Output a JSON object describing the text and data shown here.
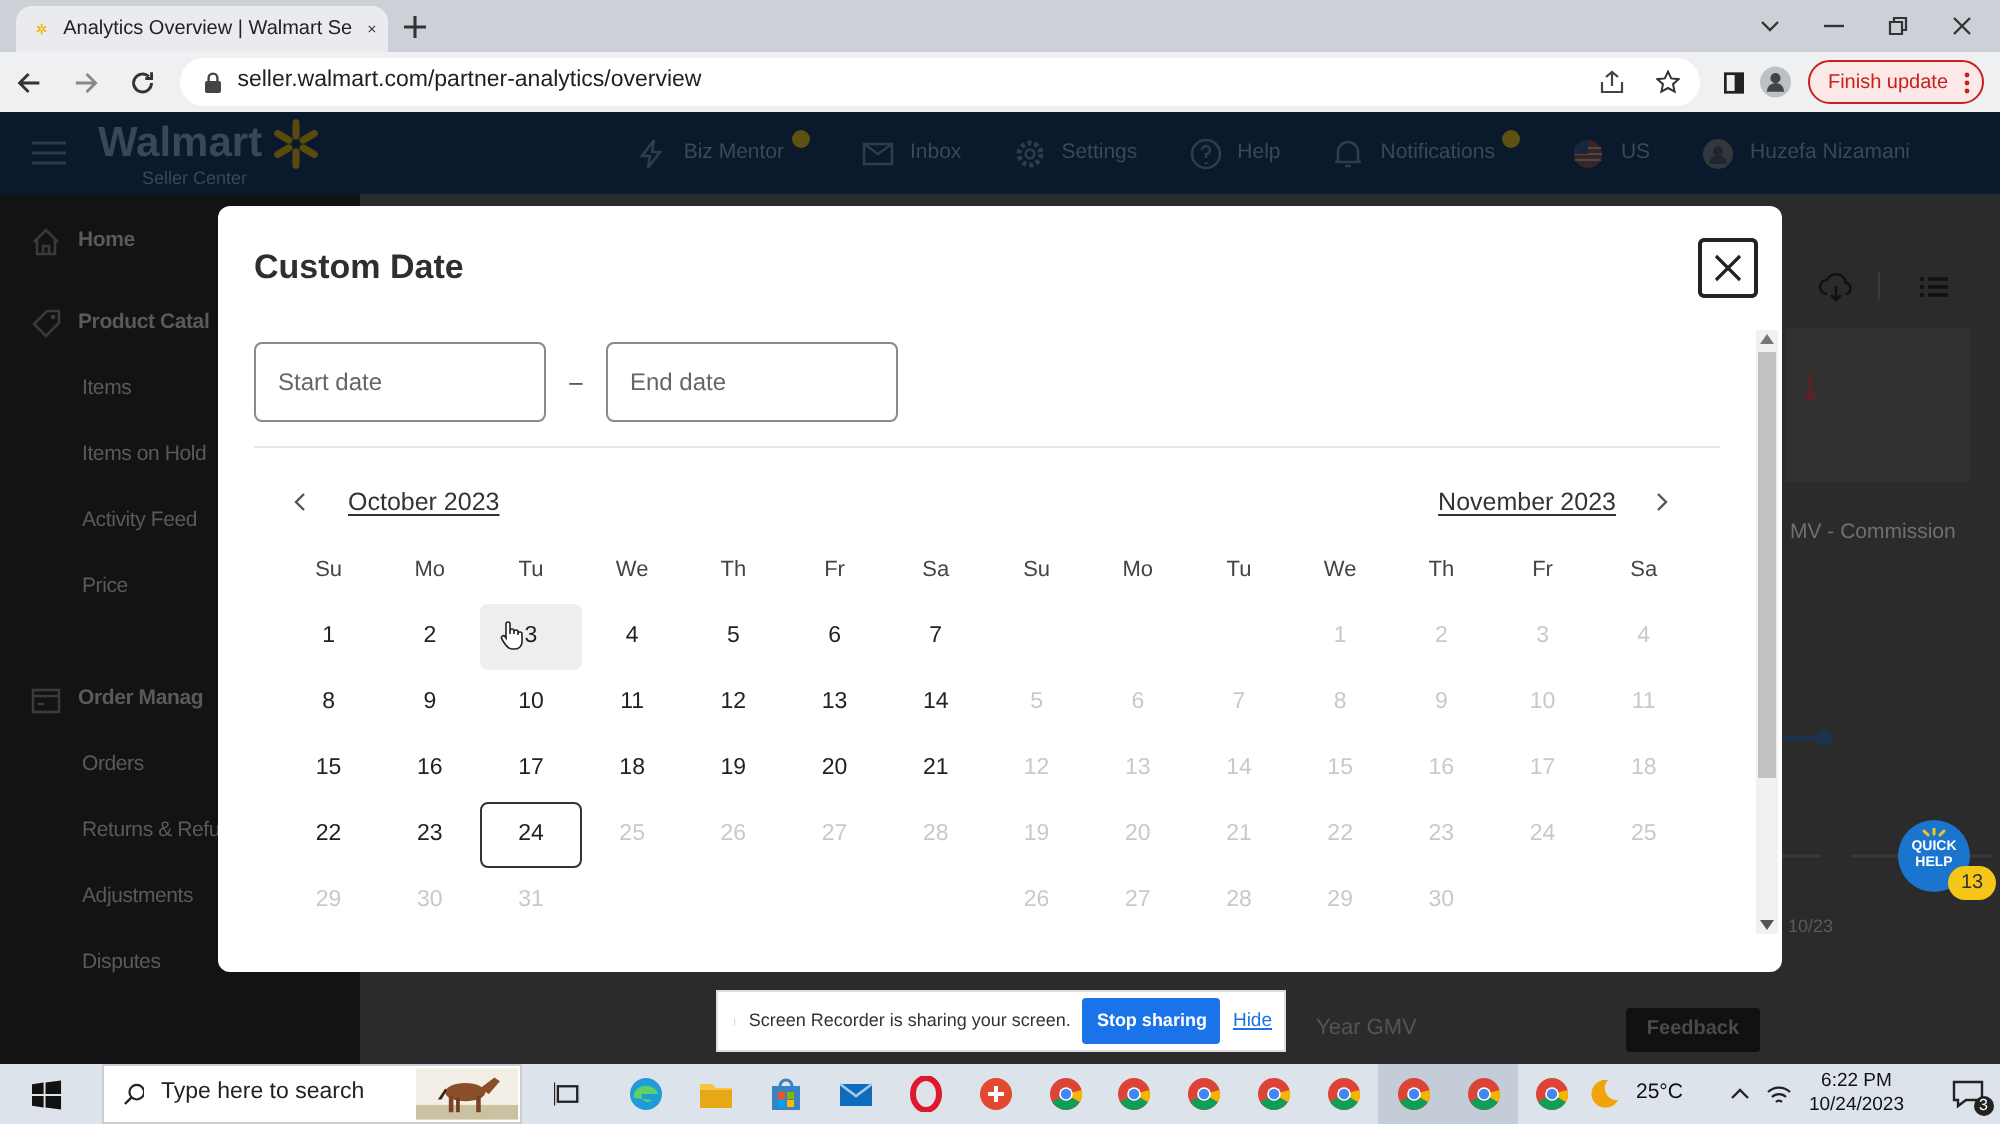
{
  "browser": {
    "tab_title": "Analytics Overview | Walmart Se",
    "url": "seller.walmart.com/partner-analytics/overview",
    "update_button": "Finish update"
  },
  "app_header": {
    "logo": "Walmart",
    "logo_subtitle": "Seller Center",
    "items": [
      {
        "label": "Biz Mentor",
        "badge": true
      },
      {
        "label": "Inbox",
        "badge": false
      },
      {
        "label": "Settings",
        "badge": false
      },
      {
        "label": "Help",
        "badge": false
      },
      {
        "label": "Notifications",
        "badge": true
      },
      {
        "label": "US",
        "badge": false
      },
      {
        "label": "Huzefa Nizamani",
        "badge": false
      }
    ]
  },
  "sidebar": {
    "items": [
      {
        "label": "Home"
      },
      {
        "label": "Product Catal",
        "children": [
          {
            "label": "Items"
          },
          {
            "label": "Items on Hold"
          },
          {
            "label": "Activity Feed"
          },
          {
            "label": "Price"
          }
        ]
      },
      {
        "label": "Order Manag",
        "children": [
          {
            "label": "Orders"
          },
          {
            "label": "Returns & Refu"
          },
          {
            "label": "Adjustments"
          },
          {
            "label": "Disputes"
          }
        ]
      }
    ]
  },
  "page": {
    "chart_label": "MV - Commission",
    "chart_date": "10/23",
    "footer_label": "Year GMV",
    "feedback_button": "Feedback"
  },
  "modal": {
    "title": "Custom Date",
    "start_field": {
      "placeholder": "Start date"
    },
    "separator": "–",
    "end_field": {
      "placeholder": "End date"
    },
    "months": [
      {
        "kind": "prev",
        "title": "October 2023",
        "weekdays": [
          "Su",
          "Mo",
          "Tu",
          "We",
          "Th",
          "Fr",
          "Sa"
        ],
        "days": [
          {
            "kind": "day",
            "label": "1",
            "disabled": false,
            "today": false,
            "hovered": false
          },
          {
            "kind": "day",
            "label": "2",
            "disabled": false,
            "today": false,
            "hovered": false
          },
          {
            "kind": "day",
            "label": "3",
            "disabled": false,
            "today": false,
            "hovered": true
          },
          {
            "kind": "day",
            "label": "4",
            "disabled": false,
            "today": false,
            "hovered": false
          },
          {
            "kind": "day",
            "label": "5",
            "disabled": false,
            "today": false,
            "hovered": false
          },
          {
            "kind": "day",
            "label": "6",
            "disabled": false,
            "today": false,
            "hovered": false
          },
          {
            "kind": "day",
            "label": "7",
            "disabled": false,
            "today": false,
            "hovered": false
          },
          {
            "kind": "day",
            "label": "8",
            "disabled": false,
            "today": false,
            "hovered": false
          },
          {
            "kind": "day",
            "label": "9",
            "disabled": false,
            "today": false,
            "hovered": false
          },
          {
            "kind": "day",
            "label": "10",
            "disabled": false,
            "today": false,
            "hovered": false
          },
          {
            "kind": "day",
            "label": "11",
            "disabled": false,
            "today": false,
            "hovered": false
          },
          {
            "kind": "day",
            "label": "12",
            "disabled": false,
            "today": false,
            "hovered": false
          },
          {
            "kind": "day",
            "label": "13",
            "disabled": false,
            "today": false,
            "hovered": false
          },
          {
            "kind": "day",
            "label": "14",
            "disabled": false,
            "today": false,
            "hovered": false
          },
          {
            "kind": "day",
            "label": "15",
            "disabled": false,
            "today": false,
            "hovered": false
          },
          {
            "kind": "day",
            "label": "16",
            "disabled": false,
            "today": false,
            "hovered": false
          },
          {
            "kind": "day",
            "label": "17",
            "disabled": false,
            "today": false,
            "hovered": false
          },
          {
            "kind": "day",
            "label": "18",
            "disabled": false,
            "today": false,
            "hovered": false
          },
          {
            "kind": "day",
            "label": "19",
            "disabled": false,
            "today": false,
            "hovered": false
          },
          {
            "kind": "day",
            "label": "20",
            "disabled": false,
            "today": false,
            "hovered": false
          },
          {
            "kind": "day",
            "label": "21",
            "disabled": false,
            "today": false,
            "hovered": false
          },
          {
            "kind": "day",
            "label": "22",
            "disabled": false,
            "today": false,
            "hovered": false
          },
          {
            "kind": "day",
            "label": "23",
            "disabled": false,
            "today": false,
            "hovered": false
          },
          {
            "kind": "day",
            "label": "24",
            "disabled": false,
            "today": true,
            "hovered": false
          },
          {
            "kind": "day",
            "label": "25",
            "disabled": true,
            "today": false,
            "hovered": false
          },
          {
            "kind": "day",
            "label": "26",
            "disabled": true,
            "today": false,
            "hovered": false
          },
          {
            "kind": "day",
            "label": "27",
            "disabled": true,
            "today": false,
            "hovered": false
          },
          {
            "kind": "day",
            "label": "28",
            "disabled": true,
            "today": false,
            "hovered": false
          },
          {
            "kind": "day",
            "label": "29",
            "disabled": true,
            "today": false,
            "hovered": false
          },
          {
            "kind": "day",
            "label": "30",
            "disabled": true,
            "today": false,
            "hovered": false
          },
          {
            "kind": "day",
            "label": "31",
            "disabled": true,
            "today": false,
            "hovered": false
          }
        ]
      },
      {
        "kind": "next",
        "title": "November 2023",
        "weekdays": [
          "Su",
          "Mo",
          "Tu",
          "We",
          "Th",
          "Fr",
          "Sa"
        ],
        "days": [
          {
            "kind": "blank"
          },
          {
            "kind": "blank"
          },
          {
            "kind": "blank"
          },
          {
            "kind": "day",
            "label": "1",
            "disabled": true,
            "today": false,
            "hovered": false
          },
          {
            "kind": "day",
            "label": "2",
            "disabled": true,
            "today": false,
            "hovered": false
          },
          {
            "kind": "day",
            "label": "3",
            "disabled": true,
            "today": false,
            "hovered": false
          },
          {
            "kind": "day",
            "label": "4",
            "disabled": true,
            "today": false,
            "hovered": false
          },
          {
            "kind": "day",
            "label": "5",
            "disabled": true,
            "today": false,
            "hovered": false
          },
          {
            "kind": "day",
            "label": "6",
            "disabled": true,
            "today": false,
            "hovered": false
          },
          {
            "kind": "day",
            "label": "7",
            "disabled": true,
            "today": false,
            "hovered": false
          },
          {
            "kind": "day",
            "label": "8",
            "disabled": true,
            "today": false,
            "hovered": false
          },
          {
            "kind": "day",
            "label": "9",
            "disabled": true,
            "today": false,
            "hovered": false
          },
          {
            "kind": "day",
            "label": "10",
            "disabled": true,
            "today": false,
            "hovered": false
          },
          {
            "kind": "day",
            "label": "11",
            "disabled": true,
            "today": false,
            "hovered": false
          },
          {
            "kind": "day",
            "label": "12",
            "disabled": true,
            "today": false,
            "hovered": false
          },
          {
            "kind": "day",
            "label": "13",
            "disabled": true,
            "today": false,
            "hovered": false
          },
          {
            "kind": "day",
            "label": "14",
            "disabled": true,
            "today": false,
            "hovered": false
          },
          {
            "kind": "day",
            "label": "15",
            "disabled": true,
            "today": false,
            "hovered": false
          },
          {
            "kind": "day",
            "label": "16",
            "disabled": true,
            "today": false,
            "hovered": false
          },
          {
            "kind": "day",
            "label": "17",
            "disabled": true,
            "today": false,
            "hovered": false
          },
          {
            "kind": "day",
            "label": "18",
            "disabled": true,
            "today": false,
            "hovered": false
          },
          {
            "kind": "day",
            "label": "19",
            "disabled": true,
            "today": false,
            "hovered": false
          },
          {
            "kind": "day",
            "label": "20",
            "disabled": true,
            "today": false,
            "hovered": false
          },
          {
            "kind": "day",
            "label": "21",
            "disabled": true,
            "today": false,
            "hovered": false
          },
          {
            "kind": "day",
            "label": "22",
            "disabled": true,
            "today": false,
            "hovered": false
          },
          {
            "kind": "day",
            "label": "23",
            "disabled": true,
            "today": false,
            "hovered": false
          },
          {
            "kind": "day",
            "label": "24",
            "disabled": true,
            "today": false,
            "hovered": false
          },
          {
            "kind": "day",
            "label": "25",
            "disabled": true,
            "today": false,
            "hovered": false
          },
          {
            "kind": "day",
            "label": "26",
            "disabled": true,
            "today": false,
            "hovered": false
          },
          {
            "kind": "day",
            "label": "27",
            "disabled": true,
            "today": false,
            "hovered": false
          },
          {
            "kind": "day",
            "label": "28",
            "disabled": true,
            "today": false,
            "hovered": false
          },
          {
            "kind": "day",
            "label": "29",
            "disabled": true,
            "today": false,
            "hovered": false
          },
          {
            "kind": "day",
            "label": "30",
            "disabled": true,
            "today": false,
            "hovered": false
          }
        ]
      }
    ]
  },
  "screen_share": {
    "message": "Screen Recorder is sharing your screen.",
    "stop_button": "Stop sharing",
    "hide_link": "Hide"
  },
  "quick_help": {
    "label": "QUICK HELP",
    "count": "13"
  },
  "taskbar": {
    "search_placeholder": "Type here to search",
    "weather": "25°C",
    "time": "6:22 PM",
    "date": "10/24/2023",
    "notification_count": "3"
  }
}
